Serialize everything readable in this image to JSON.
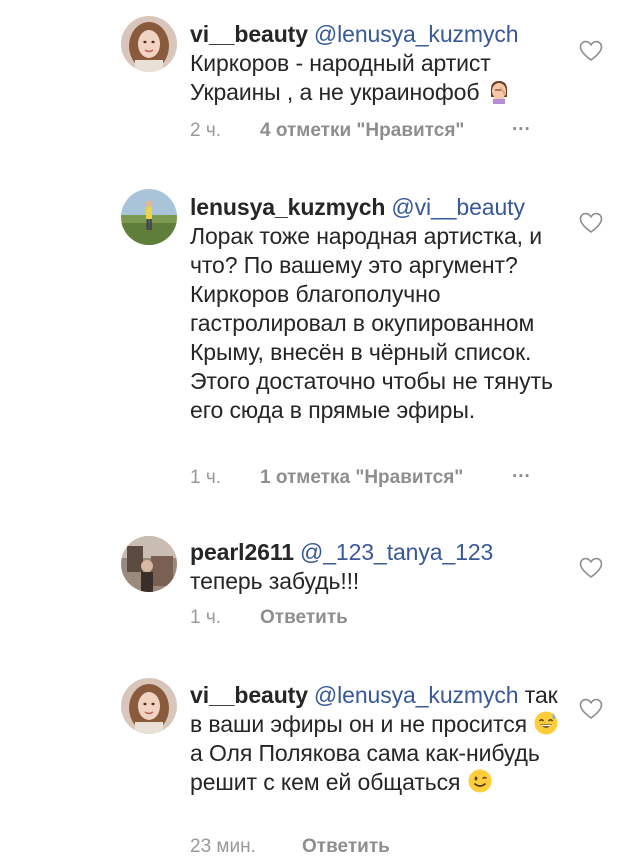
{
  "comments": [
    {
      "username": "vi__beauty",
      "mention": "@lenusya_kuzmych",
      "text": "Киркоров - народный артист Украины , а не украинофоб",
      "emoji": "facepalm-woman-emoji",
      "time": "2 ч.",
      "likes": "4 отметки \"Нравится\"",
      "more": "...",
      "avatar": "woman-avatar"
    },
    {
      "username": "lenusya_kuzmych",
      "mention": "@vi__beauty",
      "text": "Лорак тоже народная артистка, и что? По вашему это аргумент? Киркоров благополучно гастролировал в окупированном Крыму, внесён в чёрный список. Этого достаточно чтобы не тянуть его сюда в прямые эфиры.",
      "time": "1 ч.",
      "likes": "1 отметка \"Нравится\"",
      "more": "...",
      "avatar": "field-avatar"
    },
    {
      "username": "pearl2611",
      "mention": "@_123_tanya_123",
      "text": "теперь забудь!!!",
      "time": "1 ч.",
      "reply": "Ответить",
      "avatar": "room-avatar"
    },
    {
      "username": "vi__beauty",
      "mention": "@lenusya_kuzmych",
      "text_part1": "так в ваши эфиры он и не просится",
      "text_part2": "а Оля Полякова сама как-нибудь решит с кем ей общаться",
      "emoji1": "sweat-smile-emoji",
      "emoji2": "wink-emoji",
      "time": "23 мин.",
      "reply": "Ответить",
      "avatar": "woman-avatar"
    }
  ],
  "colors": {
    "text": "#262626",
    "mention": "#385898",
    "meta": "#999999",
    "heart": "#8e8e8e"
  }
}
